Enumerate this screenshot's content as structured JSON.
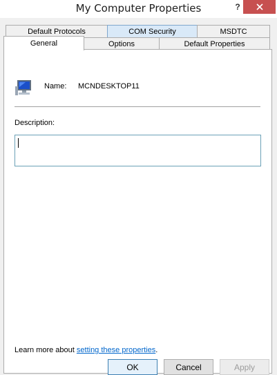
{
  "window": {
    "title": "My Computer Properties",
    "help_glyph": "?",
    "close_glyph": "✕"
  },
  "tabs": {
    "row1": [
      {
        "label": "Default Protocols",
        "state": "normal"
      },
      {
        "label": "COM Security",
        "state": "hover"
      },
      {
        "label": "MSDTC",
        "state": "normal"
      }
    ],
    "row2": [
      {
        "label": "General",
        "state": "selected"
      },
      {
        "label": "Options",
        "state": "normal"
      },
      {
        "label": "Default Properties",
        "state": "normal"
      }
    ]
  },
  "general": {
    "icon": "computer-monitor-icon",
    "name_label": "Name:",
    "name_value": "MCNDESKTOP11",
    "description_label": "Description:",
    "description_value": "",
    "learn_prefix": "Learn more about ",
    "learn_link": "setting these properties",
    "learn_suffix": "."
  },
  "buttons": {
    "ok": "OK",
    "cancel": "Cancel",
    "apply": "Apply",
    "apply_enabled": false
  },
  "colors": {
    "close_button": "#c75050",
    "hover_tab": "#d9e9f8",
    "link": "#0066cc",
    "input_border": "#6aa0b6",
    "dialog_bg": "#f0f0f0"
  }
}
